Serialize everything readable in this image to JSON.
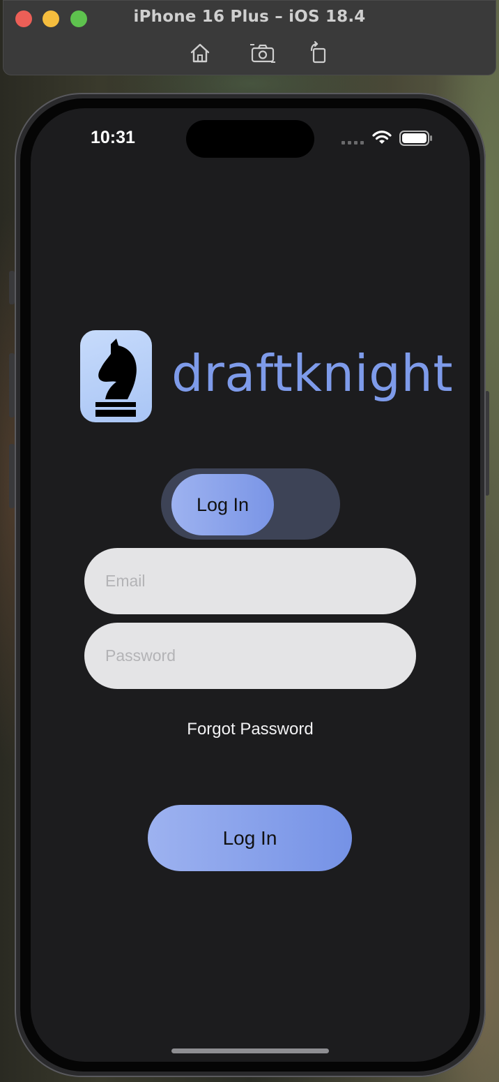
{
  "window": {
    "title": "iPhone 16 Plus – iOS 18.4",
    "toolbar_icons": [
      "home-icon",
      "screenshot-icon",
      "rotate-icon"
    ]
  },
  "status_bar": {
    "time": "10:31",
    "icons": [
      "cellular-signal-icon",
      "wifi-icon",
      "battery-icon"
    ]
  },
  "brand": {
    "name": "draftknight",
    "logo_icon": "chess-knight-icon",
    "accent_color": "#7e9bea",
    "logo_tile_color": "#b9d0f8"
  },
  "mode_toggle": {
    "selected_label": "Log In"
  },
  "form": {
    "email_placeholder": "Email",
    "email_value": "",
    "password_placeholder": "Password",
    "password_value": "",
    "forgot_label": "Forgot Password",
    "submit_label": "Log In"
  },
  "colors": {
    "screen_background": "#1c1c1e",
    "field_background": "#e4e4e6",
    "button_gradient_start": "#9db2f0",
    "button_gradient_end": "#7592e6",
    "toggle_track": "#3d4356"
  }
}
